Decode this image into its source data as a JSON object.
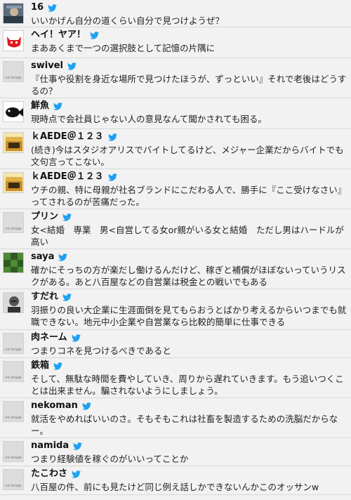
{
  "accent": "#1da1f2",
  "tweets": [
    {
      "name": "16",
      "text": "いいかげん自分の道くらい自分で見つけようぜ？",
      "avatar": "photo"
    },
    {
      "name": "ヘイ！ヤア！",
      "text": "まああくまで一つの選択肢として記憶の片隅に",
      "avatar": "red-devil-icon"
    },
    {
      "name": "swivel",
      "text": "『仕事や役割を身近な場所で見つけたほうが、ずっといい』それで老後はどうするの？",
      "avatar": "no-image"
    },
    {
      "name": "鮮魚",
      "text": "現時点で会社員じゃない人の意見なんて聞かされても困る。",
      "avatar": "fish-icon"
    },
    {
      "name": "ｋAEDE＠１２３",
      "text": "(続き)今はスタジオアリスでバイトしてるけど、メジャー企業だからバイトでも文句言ってこない。",
      "avatar": "box-icon"
    },
    {
      "name": "ｋAEDE＠１２３",
      "text": "ウチの親、特に母親が社名ブランドにこだわる人で、勝手に『ここ受けなさい』ってされるのが苦痛だった。",
      "avatar": "box-icon"
    },
    {
      "name": "プリン",
      "text": "女<結婚　専業　男<自営してる女or親がいる女と結婚　ただし男はハードルが高い",
      "avatar": "no-image"
    },
    {
      "name": "saya",
      "text": "確かにそっちの方が楽だし働けるんだけど、稼ぎと補償がほぼないっていうリスクがある。あと八百屋などの自営業は税金との戦いでもある",
      "avatar": "green-pattern"
    },
    {
      "name": "すだれ",
      "text": "羽振りの良い大企業に生涯面倒を見てもらおうとばかり考えるからいつまでも就職できない。地元中小企業や自営業なら比較的簡単に仕事できる",
      "avatar": "portrait"
    },
    {
      "name": "肉ネーム",
      "text": "つまりコネを見つけるべきであると",
      "avatar": "no-image"
    },
    {
      "name": "鉄箱",
      "text": "そして、無駄な時間を費やしていき、周りから遅れていきます。もう追いつくことは出来ません。騙されないようにしましょう。",
      "avatar": "no-image"
    },
    {
      "name": "nekoman",
      "text": "就活をやめればいいのさ。そもそもこれは社畜を製造するための洗脳だからなー。",
      "avatar": "no-image"
    },
    {
      "name": "namida",
      "text": "つまり経験値を稼ぐのがいいってことか",
      "avatar": "no-image"
    },
    {
      "name": "たこわさ",
      "text": "八百屋の件、前にも見たけど同じ例え話しかできないんかこのオッサンw",
      "avatar": "no-image"
    }
  ],
  "no_image_label": "no image"
}
